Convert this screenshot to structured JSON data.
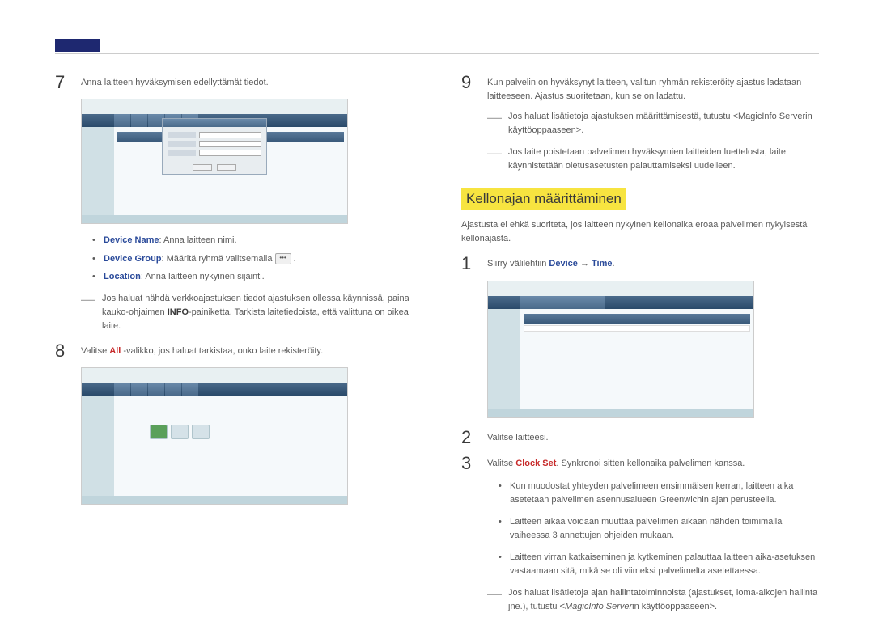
{
  "left": {
    "step7": {
      "num": "7",
      "text": "Anna laitteen hyväksymisen edellyttämät tiedot."
    },
    "bullets7": [
      {
        "label": "Device Name",
        "text": ": Anna laitteen nimi."
      },
      {
        "label": "Device Group",
        "text": ": Määritä ryhmä valitsemalla "
      },
      {
        "label": "Location",
        "text": ": Anna laitteen nykyinen sijainti."
      }
    ],
    "dots_after": ".",
    "dash7": {
      "pre": "Jos haluat nähdä verkkoajastuksen tiedot ajastuksen ollessa käynnissä, paina kauko-ohjaimen ",
      "bold": "INFO",
      "post": "-painiketta. Tarkista laitetiedoista, että valittuna on oikea laite."
    },
    "step8": {
      "num": "8",
      "pre": "Valitse ",
      "bold": "All",
      "post": " -valikko, jos haluat tarkistaa, onko laite rekisteröity."
    }
  },
  "right": {
    "step9": {
      "num": "9",
      "text": "Kun palvelin on hyväksynyt laitteen, valitun ryhmän rekisteröity ajastus ladataan laitteeseen. Ajastus suoritetaan, kun se on ladattu."
    },
    "dash9a": "Jos haluat lisätietoja ajastuksen määrittämisestä, tutustu <MagicInfo Serverin käyttöoppaaseen>.",
    "dash9b": "Jos laite poistetaan palvelimen hyväksymien laitteiden luettelosta, laite käynnistetään oletusasetusten palauttamiseksi uudelleen.",
    "section_title": "Kellonajan määrittäminen",
    "section_intro": "Ajastusta ei ehkä suoriteta, jos laitteen nykyinen kellonaika eroaa palvelimen nykyisestä kellonajasta.",
    "step1": {
      "num": "1",
      "pre": "Siirry välilehtiin ",
      "bold1": "Device",
      "arrow": " → ",
      "bold2": "Time",
      "post": "."
    },
    "step2": {
      "num": "2",
      "text": "Valitse laitteesi."
    },
    "step3": {
      "num": "3",
      "pre": "Valitse ",
      "bold": "Clock Set",
      "post": ". Synkronoi sitten kellonaika palvelimen kanssa."
    },
    "subbullets": [
      "Kun muodostat yhteyden palvelimeen ensimmäisen kerran, laitteen aika asetetaan palvelimen asennusalueen Greenwichin ajan perusteella.",
      "Laitteen aikaa voidaan muuttaa palvelimen aikaan nähden toimimalla vaiheessa 3 annettujen ohjeiden mukaan.",
      "Laitteen virran katkaiseminen ja kytkeminen palauttaa laitteen aika-asetuksen vastaamaan sitä, mikä se oli viimeksi palvelimelta asetettaessa."
    ],
    "dashlast": {
      "pre": "Jos haluat lisätietoja ajan hallintatoiminnoista (ajastukset, loma-aikojen hallinta jne.), tutustu <",
      "ital": "MagicInfo Server",
      "post": "in käyttöoppaaseen>."
    }
  }
}
